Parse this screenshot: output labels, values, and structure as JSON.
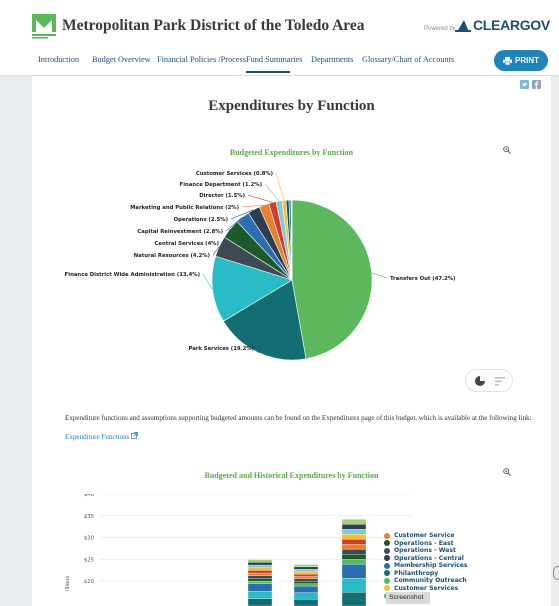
{
  "header": {
    "site_title": "Metropolitan Park District of the Toledo Area",
    "powered_by": "Powered by",
    "brand": "CLEARGOV",
    "print_label": "PRINT"
  },
  "nav": {
    "items": [
      {
        "label": "Introduction"
      },
      {
        "label": "Budget Overview"
      },
      {
        "label": "Financial Policies /Process"
      },
      {
        "label": "Fund Summaries",
        "active": true
      },
      {
        "label": "Departments"
      },
      {
        "label": "Glossary/Chart of Accounts"
      }
    ]
  },
  "page": {
    "title": "Expenditures by Function",
    "description": "Expenditure functions and assumptions supporting budgeted amounts can be found on the Expenditures page of this budget, which is available at the following link:",
    "link_text": "Expenditure Functions"
  },
  "tooltip": "Screenshot",
  "colors": {
    "accent": "#1f83bc",
    "brand": "#1b4e78",
    "chart_title": "#5fa84a"
  },
  "chart_data": [
    {
      "type": "pie",
      "title": "Budgeted Expenditures by Function",
      "slices": [
        {
          "label": "Transfers Out (47.2%)",
          "value": 47.2,
          "color": "#5cb85c"
        },
        {
          "label": "Park Services (19.2%)",
          "value": 19.2,
          "color": "#126e73"
        },
        {
          "label": "Finance District Wide Administration (13.4%)",
          "value": 13.4,
          "color": "#29bcc6"
        },
        {
          "label": "Natural Resources (4.2%)",
          "value": 4.2,
          "color": "#3e4a53"
        },
        {
          "label": "Central Services (4%)",
          "value": 4.0,
          "color": "#1c5a2c"
        },
        {
          "label": "Capital Reinvestment (2.8%)",
          "value": 2.8,
          "color": "#2a6eb0"
        },
        {
          "label": "Operations (2.5%)",
          "value": 2.5,
          "color": "#2c3e50"
        },
        {
          "label": "Marketing and Public Relations (2%)",
          "value": 2.0,
          "color": "#e8812e"
        },
        {
          "label": "Director (1.5%)",
          "value": 1.5,
          "color": "#d13c2e"
        },
        {
          "label": "Finance Department (1.2%)",
          "value": 1.2,
          "color": "#7fc9d8"
        },
        {
          "label": "Customer Services (0.8%)",
          "value": 0.8,
          "color": "#f1c232"
        },
        {
          "label": "",
          "value": 0.6,
          "color": "#1b4e78"
        },
        {
          "label": "",
          "value": 0.4,
          "color": "#0f7f78"
        },
        {
          "label": "",
          "value": 0.2,
          "color": "#9fd27a"
        }
      ]
    },
    {
      "type": "bar",
      "title": "Budgeted and Historical Expenditures by Function",
      "ylabel": "illions",
      "y_ticks": [
        "$20",
        "$25",
        "$30",
        "$35",
        "$40"
      ],
      "ylim": [
        20,
        40
      ],
      "bars": [
        {
          "total": 24.9
        },
        {
          "total": 23.8
        },
        {
          "total": 34.2
        }
      ],
      "legend": [
        {
          "label": "Customer Service",
          "color": "#e8812e"
        },
        {
          "label": "Operations - East",
          "color": "#1c5a2c"
        },
        {
          "label": "Operations - West",
          "color": "#3e4a53"
        },
        {
          "label": "Operations - Central",
          "color": "#2c3e50"
        },
        {
          "label": "Membership Services",
          "color": "#2a6eb0"
        },
        {
          "label": "Philanthropy",
          "color": "#126e73"
        },
        {
          "label": "Community Outreach",
          "color": "#5cb85c"
        },
        {
          "label": "Customer Services",
          "color": "#f1c232"
        },
        {
          "label": "...rtment",
          "color": "#29bcc6"
        }
      ]
    }
  ]
}
